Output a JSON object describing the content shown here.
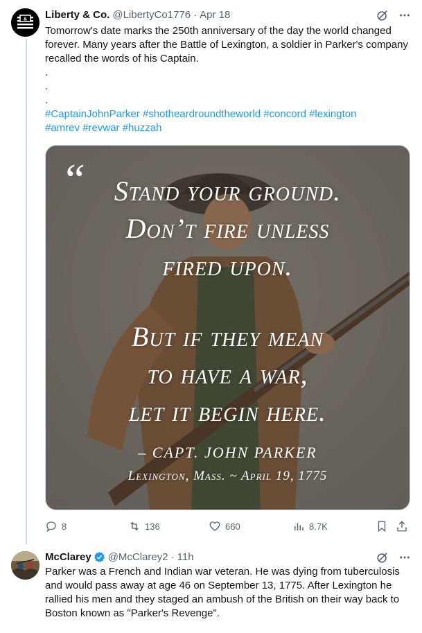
{
  "tweet1": {
    "display_name": "Liberty & Co.",
    "handle": "@LibertyCo1776",
    "separator": "·",
    "time": "Apr 18",
    "text_line": "Tomorrow's date marks the 250th anniversary of the day the world changed forever. Many years after the Battle of Lexington, a soldier in Parker's company recalled the words of his Captain.",
    "dots": [
      ".",
      ".",
      "."
    ],
    "hashtags_line1": "#CaptainJohnParker #shotheardroundtheworld #concord #lexington",
    "hashtags_line2": "#amrev #revwar #huzzah",
    "image_quote": {
      "open_quote": "“",
      "line1": "Stand your ground.",
      "line2": "Don’t fire unless",
      "line3": "fired upon.",
      "line4": "But if they mean",
      "line5": "to have a war,",
      "line6": "let it begin here.",
      "attribution": "– CAPT. JOHN PARKER",
      "place_date": "Lexington, Mass. ~ April 19, 1775"
    },
    "metrics": {
      "replies": "8",
      "retweets": "136",
      "likes": "660",
      "views": "8.7K"
    }
  },
  "tweet2": {
    "display_name": "McClarey",
    "handle": "@McClarey2",
    "separator": "·",
    "time": "11h",
    "text": "Parker was a French and Indian war veteran.  He was dying from tuberculosis and would pass away at age 46 on September 13, 1775.  After Lexington he rallied his men and they staged an ambush of the British on their way back to Boston known as  \"Parker's Revenge\"."
  },
  "colors": {
    "text": "#0f1419",
    "secondary": "#536471",
    "link": "#1d9bf0",
    "verified": "#1d9bf0",
    "thread_line": "#cfd9de"
  }
}
